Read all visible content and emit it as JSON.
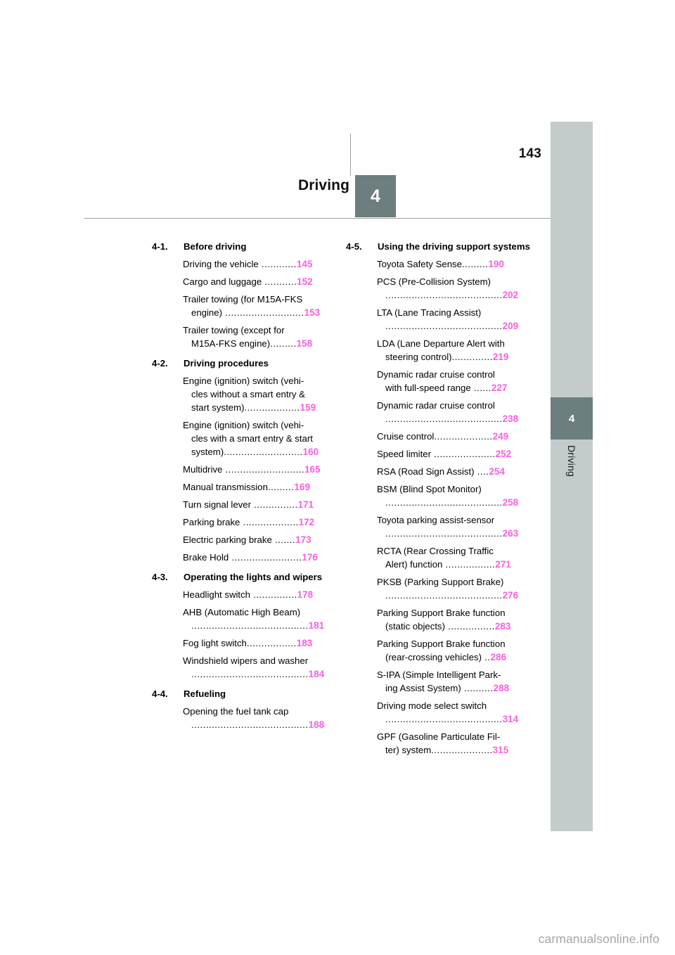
{
  "page": {
    "number": "143",
    "chapter_number": "4",
    "chapter_title": "Driving",
    "watermark": "carmanualsonline.info",
    "accent_color": "#f85fe0",
    "tab_dark_color": "#6c7e7e",
    "tab_light_color": "#c3ccca"
  },
  "sidebar": {
    "chapter_number": "4",
    "chapter_label": "Driving"
  },
  "toc": {
    "columns": [
      {
        "sections": [
          {
            "number": "4-1.",
            "title": "Before driving",
            "entries": [
              {
                "text": "Driving the vehicle",
                "dots": " ............",
                "page": "145",
                "lines": [
                  "Driving the vehicle ............145"
                ]
              },
              {
                "text": "Cargo and luggage",
                "dots": " ...........",
                "page": "152",
                "lines": [
                  "Cargo and luggage ...........152"
                ]
              },
              {
                "text": "Trailer towing (for M15A-FKS engine)",
                "dots": " ...........................",
                "page": "153",
                "lines": [
                  "Trailer towing (for M15A-FKS",
                  "engine) ...........................153"
                ]
              },
              {
                "text": "Trailer towing (except for M15A-FKS engine)",
                "dots": ".........",
                "page": "158",
                "lines": [
                  "Trailer towing (except for",
                  "M15A-FKS engine).........158"
                ]
              }
            ]
          },
          {
            "number": "4-2.",
            "title": "Driving procedures",
            "entries": [
              {
                "text": "Engine (ignition) switch (vehicles without a smart entry & start system)",
                "dots": "...................",
                "page": "159",
                "lines": [
                  "Engine (ignition) switch (vehi-",
                  "cles without a smart entry &",
                  "start system)...................159"
                ]
              },
              {
                "text": "Engine (ignition) switch (vehicles with a smart entry & start system)",
                "dots": "...........................",
                "page": "160",
                "lines": [
                  "Engine (ignition) switch (vehi-",
                  "cles with a smart entry & start",
                  "system)...........................160"
                ]
              },
              {
                "text": "Multidrive",
                "dots": " ...........................",
                "page": "165",
                "lines": [
                  "Multidrive ...........................165"
                ]
              },
              {
                "text": "Manual transmission",
                "dots": ".........",
                "page": "169",
                "lines": [
                  "Manual transmission.........169"
                ]
              },
              {
                "text": "Turn signal lever",
                "dots": " ...............",
                "page": "171",
                "lines": [
                  "Turn signal lever ...............171"
                ]
              },
              {
                "text": "Parking brake",
                "dots": " ...................",
                "page": "172",
                "lines": [
                  "Parking brake ...................172"
                ]
              },
              {
                "text": "Electric parking brake",
                "dots": " .......",
                "page": "173",
                "lines": [
                  "Electric parking brake .......173"
                ]
              },
              {
                "text": "Brake Hold",
                "dots": " ........................",
                "page": "176",
                "lines": [
                  "Brake Hold ........................176"
                ]
              }
            ]
          },
          {
            "number": "4-3.",
            "title": "Operating the lights and wipers",
            "entries": [
              {
                "text": "Headlight switch",
                "dots": " ...............",
                "page": "178",
                "lines": [
                  "Headlight switch ...............178"
                ]
              },
              {
                "text": "AHB (Automatic High Beam)",
                "dots": " ........................................",
                "page": "181",
                "lines": [
                  "AHB (Automatic High Beam)",
                  "........................................181"
                ]
              },
              {
                "text": "Fog light switch",
                "dots": ".................",
                "page": "183",
                "lines": [
                  "Fog light switch.................183"
                ]
              },
              {
                "text": "Windshield wipers and washer",
                "dots": " ........................................",
                "page": "184",
                "lines": [
                  "Windshield wipers and washer",
                  "........................................184"
                ]
              }
            ]
          },
          {
            "number": "4-4.",
            "title": "Refueling",
            "entries": [
              {
                "text": "Opening the fuel tank cap",
                "dots": " ........................................",
                "page": "188",
                "lines": [
                  "Opening the fuel tank cap",
                  "........................................188"
                ]
              }
            ]
          }
        ]
      },
      {
        "sections": [
          {
            "number": "4-5.",
            "title": "Using the driving support systems",
            "entries": [
              {
                "text": "Toyota Safety Sense",
                "dots": ".........",
                "page": "190",
                "lines": [
                  "Toyota Safety Sense.........190"
                ]
              },
              {
                "text": "PCS (Pre-Collision System)",
                "dots": " ........................................",
                "page": "202",
                "lines": [
                  "PCS (Pre-Collision System)",
                  "........................................202"
                ]
              },
              {
                "text": "LTA (Lane Tracing Assist)",
                "dots": " ........................................",
                "page": "209",
                "lines": [
                  "LTA (Lane Tracing Assist)",
                  "........................................209"
                ]
              },
              {
                "text": "LDA (Lane Departure Alert with steering control)",
                "dots": "..............",
                "page": "219",
                "lines": [
                  "LDA (Lane Departure Alert with",
                  "steering control)..............219"
                ]
              },
              {
                "text": "Dynamic radar cruise control with full-speed range",
                "dots": " ......",
                "page": "227",
                "lines": [
                  "Dynamic radar cruise control",
                  "with full-speed range ......227"
                ]
              },
              {
                "text": "Dynamic radar cruise control",
                "dots": " ........................................",
                "page": "238",
                "lines": [
                  "Dynamic radar cruise control",
                  "........................................238"
                ]
              },
              {
                "text": "Cruise control",
                "dots": "....................",
                "page": "249",
                "lines": [
                  "Cruise control....................249"
                ]
              },
              {
                "text": "Speed limiter",
                "dots": " .....................",
                "page": "252",
                "lines": [
                  "Speed limiter .....................252"
                ]
              },
              {
                "text": "RSA (Road Sign Assist)",
                "dots": " ....",
                "page": "254",
                "lines": [
                  "RSA (Road Sign Assist) ....254"
                ]
              },
              {
                "text": "BSM (Blind Spot Monitor)",
                "dots": " ........................................",
                "page": "258",
                "lines": [
                  "BSM (Blind Spot Monitor)",
                  "........................................258"
                ]
              },
              {
                "text": "Toyota parking assist-sensor",
                "dots": " ........................................",
                "page": "263",
                "lines": [
                  "Toyota parking assist-sensor",
                  "........................................263"
                ]
              },
              {
                "text": "RCTA (Rear Crossing Traffic Alert) function",
                "dots": " .................",
                "page": "271",
                "lines": [
                  "RCTA (Rear Crossing Traffic",
                  "Alert) function .................271"
                ]
              },
              {
                "text": "PKSB (Parking Support Brake)",
                "dots": " ........................................",
                "page": "276",
                "lines": [
                  "PKSB (Parking Support Brake)",
                  "........................................276"
                ]
              },
              {
                "text": "Parking Support Brake function (static objects)",
                "dots": " ................",
                "page": "283",
                "lines": [
                  "Parking Support Brake function",
                  "(static objects) ................283"
                ]
              },
              {
                "text": "Parking Support Brake function (rear-crossing vehicles)",
                "dots": " ..",
                "page": "286",
                "lines": [
                  "Parking Support Brake function",
                  "(rear-crossing vehicles) ..286"
                ]
              },
              {
                "text": "S-IPA (Simple Intelligent Parking Assist System)",
                "dots": " ..........",
                "page": "288",
                "lines": [
                  "S-IPA (Simple Intelligent Park-",
                  "ing Assist System) ..........288"
                ]
              },
              {
                "text": "Driving mode select switch",
                "dots": " ........................................",
                "page": "314",
                "lines": [
                  "Driving mode select switch",
                  "........................................314"
                ]
              },
              {
                "text": "GPF (Gasoline Particulate Filter) system",
                "dots": ".....................",
                "page": "315",
                "lines": [
                  "GPF (Gasoline Particulate Fil-",
                  "ter) system.....................315"
                ]
              }
            ]
          }
        ]
      }
    ]
  }
}
